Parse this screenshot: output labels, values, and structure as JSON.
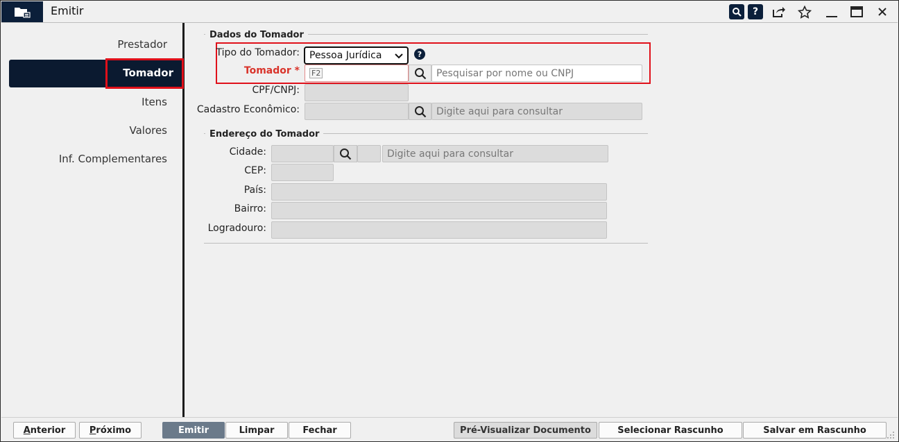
{
  "window": {
    "title": "Emitir"
  },
  "titlebar_icons": [
    "folder-icon",
    "search-icon",
    "help-icon",
    "share-icon",
    "star-icon",
    "minimize-icon",
    "maximize-icon",
    "close-icon"
  ],
  "sidebar": {
    "items": [
      {
        "label": "Prestador",
        "active": false
      },
      {
        "label": "Tomador",
        "active": true
      },
      {
        "label": "Itens",
        "active": false
      },
      {
        "label": "Valores",
        "active": false
      },
      {
        "label": "Inf. Complementares",
        "active": false
      }
    ]
  },
  "dados_tomador": {
    "section_title": "Dados do Tomador",
    "tipo_label": "Tipo do Tomador:",
    "tipo_value": "Pessoa Jurídica",
    "tomador_label": "Tomador *",
    "tomador_hint": "F2",
    "tomador_placeholder": "Pesquisar por nome ou CNPJ",
    "cpf_label": "CPF/CNPJ:",
    "cadastro_label": "Cadastro Econômico:",
    "cadastro_placeholder": "Digite aqui para consultar"
  },
  "endereco": {
    "section_title": "Endereço do Tomador",
    "cidade_label": "Cidade:",
    "cidade_placeholder": "Digite aqui para consultar",
    "cep_label": "CEP:",
    "pais_label": "País:",
    "bairro_label": "Bairro:",
    "logradouro_label": "Logradouro:"
  },
  "footer": {
    "anterior_first": "A",
    "anterior_rest": "nterior",
    "proximo_first": "P",
    "proximo_rest": "róximo",
    "emitir": "Emitir",
    "limpar": "Limpar",
    "fechar": "Fechar",
    "pre_visualizar": "Pré-Visualizar Documento",
    "selecionar_rascunho": "Selecionar Rascunho",
    "salvar_rascunho": "Salvar em Rascunho"
  },
  "colors": {
    "navy": "#0b1f3a",
    "highlight_red": "#e0101a",
    "required_red": "#d9342b"
  }
}
